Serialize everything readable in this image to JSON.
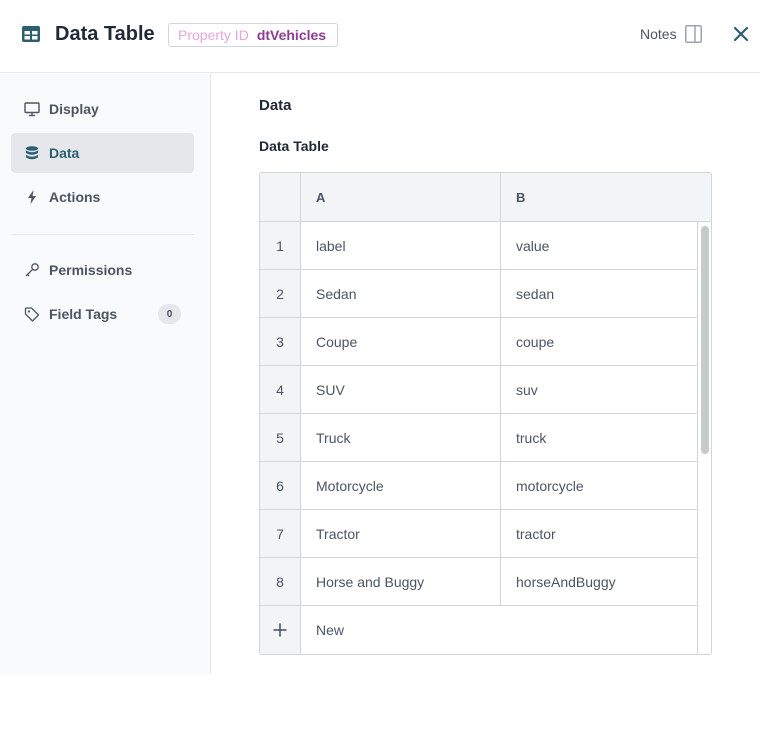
{
  "header": {
    "title": "Data Table",
    "property_id_label": "Property ID",
    "property_id_value": "dtVehicles",
    "notes_label": "Notes"
  },
  "sidebar": {
    "items": [
      {
        "label": "Display",
        "icon": "monitor-icon",
        "active": false
      },
      {
        "label": "Data",
        "icon": "database-icon",
        "active": true
      },
      {
        "label": "Actions",
        "icon": "lightning-icon",
        "active": false
      },
      {
        "label": "Permissions",
        "icon": "key-icon",
        "active": false
      },
      {
        "label": "Field Tags",
        "icon": "tag-icon",
        "active": false,
        "badge": "0"
      }
    ]
  },
  "main": {
    "section_title": "Data",
    "field_label": "Data Table",
    "table": {
      "columns": [
        "A",
        "B"
      ],
      "rows": [
        {
          "num": "1",
          "a": "label",
          "b": "value"
        },
        {
          "num": "2",
          "a": "Sedan",
          "b": "sedan"
        },
        {
          "num": "3",
          "a": "Coupe",
          "b": "coupe"
        },
        {
          "num": "4",
          "a": "SUV",
          "b": "suv"
        },
        {
          "num": "5",
          "a": "Truck",
          "b": "truck"
        },
        {
          "num": "6",
          "a": "Motorcycle",
          "b": "motorcycle"
        },
        {
          "num": "7",
          "a": "Tractor",
          "b": "tractor"
        },
        {
          "num": "8",
          "a": "Horse and Buggy",
          "b": "horseAndBuggy"
        }
      ],
      "new_row_label": "New"
    }
  },
  "colors": {
    "accent": "#2c5f73",
    "badge_key": "#e7a6d9",
    "badge_value": "#8e3b96"
  }
}
